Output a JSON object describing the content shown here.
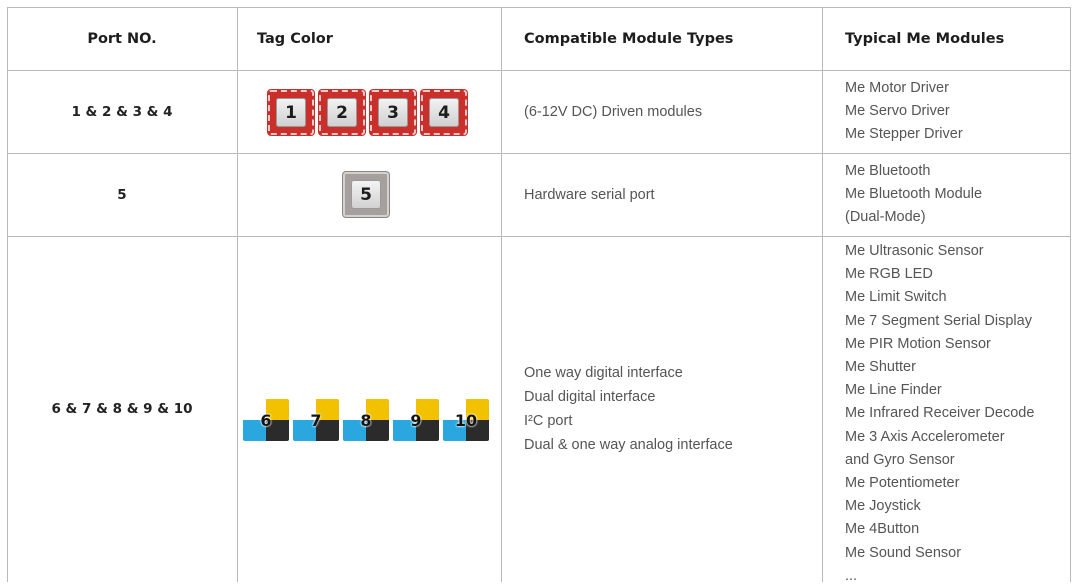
{
  "headers": {
    "port": "Port NO.",
    "tag": "Tag Color",
    "types": "Compatible Module Types",
    "modules": "Typical Me Modules"
  },
  "rows": [
    {
      "port": "1 & 2 & 3 & 4",
      "tags": [
        "1",
        "2",
        "3",
        "4"
      ],
      "tag_color": "#c9302c",
      "types": [
        "(6-12V DC) Driven modules"
      ],
      "modules": [
        "Me Motor Driver",
        "Me Servo Driver",
        "Me Stepper Driver"
      ]
    },
    {
      "port": "5",
      "tags": [
        "5"
      ],
      "tag_color": "#a59f9d",
      "types": [
        "Hardware serial port"
      ],
      "modules": [
        "Me Bluetooth",
        "Me Bluetooth Module",
        "(Dual-Mode)"
      ]
    },
    {
      "port": "6 & 7 & 8 & 9 & 10",
      "tags": [
        "6",
        "7",
        "8",
        "9",
        "10"
      ],
      "tag_colors": [
        "#f2c200",
        "#2aa7df",
        "#2b2b2b",
        "#ffffff"
      ],
      "types": [
        "One way digital interface",
        "Dual digital interface",
        "I²C port",
        "Dual & one way analog interface"
      ],
      "modules": [
        "Me Ultrasonic Sensor",
        "Me RGB LED",
        "Me Limit Switch",
        "Me 7 Segment Serial Display",
        "Me PIR Motion Sensor",
        "Me Shutter",
        "Me Line Finder",
        "Me Infrared Receiver Decode",
        "Me 3 Axis Accelerometer",
        "and Gyro Sensor",
        "Me Potentiometer",
        "Me Joystick",
        "Me 4Button",
        "Me Sound Sensor",
        "..."
      ]
    }
  ]
}
